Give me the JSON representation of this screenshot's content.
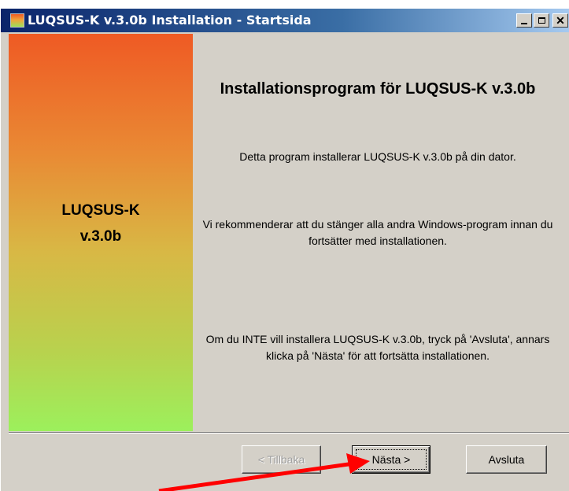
{
  "window": {
    "title": "LUQSUS-K v.3.0b Installation - Startsida",
    "controls": {
      "minimize_icon": "minimize-icon",
      "maximize_icon": "maximize-icon",
      "close_icon": "close-icon"
    }
  },
  "sidebar": {
    "product_name": "LUQSUS-K",
    "version": "v.3.0b",
    "gradient_colors": [
      "#ef5a24",
      "#9cf05c"
    ]
  },
  "content": {
    "heading": "Installationsprogram för LUQSUS-K v.3.0b",
    "intro": "Detta program installerar LUQSUS-K v.3.0b på din dator.",
    "recommendation": "Vi rekommenderar att du stänger alla andra Windows-program innan du fortsätter med installationen.",
    "instructions": "Om du INTE vill installera LUQSUS-K v.3.0b, tryck på 'Avsluta', annars klicka på 'Nästa' för att fortsätta installationen."
  },
  "buttons": {
    "back": "< Tillbaka",
    "next": "Nästa >",
    "exit": "Avsluta"
  },
  "annotation": {
    "arrow_color": "#ff0000"
  }
}
